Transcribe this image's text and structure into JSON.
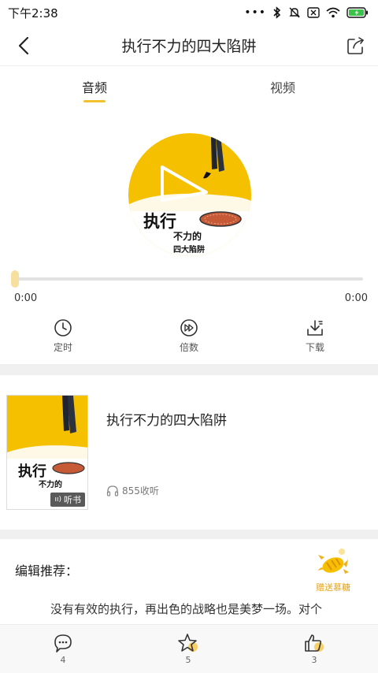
{
  "status_bar": {
    "time": "下午2:38",
    "icons": [
      "dots-icon",
      "bluetooth-icon",
      "mute-icon",
      "sim-icon",
      "wifi-icon",
      "battery-icon"
    ]
  },
  "nav": {
    "title": "执行不力的四大陷阱",
    "back_icon": "chevron-left-icon",
    "share_icon": "share-icon"
  },
  "tabs": [
    {
      "label": "音频",
      "active": true
    },
    {
      "label": "视频",
      "active": false
    }
  ],
  "cover": {
    "art_text_1": "执行",
    "art_text_2": "不力的",
    "art_text_3": "四大陷阱"
  },
  "player": {
    "progress": 0,
    "time_current": "0:00",
    "time_total": "0:00"
  },
  "controls": [
    {
      "label": "定时",
      "icon": "clock-icon"
    },
    {
      "label": "倍数",
      "icon": "speed-icon"
    },
    {
      "label": "下载",
      "icon": "download-icon"
    }
  ],
  "book": {
    "title": "执行不力的四大陷阱",
    "badge": "听书",
    "listen_count": "855收听"
  },
  "recommend": {
    "label": "编辑推荐：",
    "gift_label": "赠送慕糖",
    "text": "没有有效的执行，再出色的战略也是美梦一场。对个"
  },
  "bottom_bar": {
    "comments": "4",
    "favorites": "5",
    "likes": "3"
  },
  "colors": {
    "accent": "#f2c12e",
    "cover_yellow": "#f5c000",
    "divider": "#f0f0f0"
  }
}
